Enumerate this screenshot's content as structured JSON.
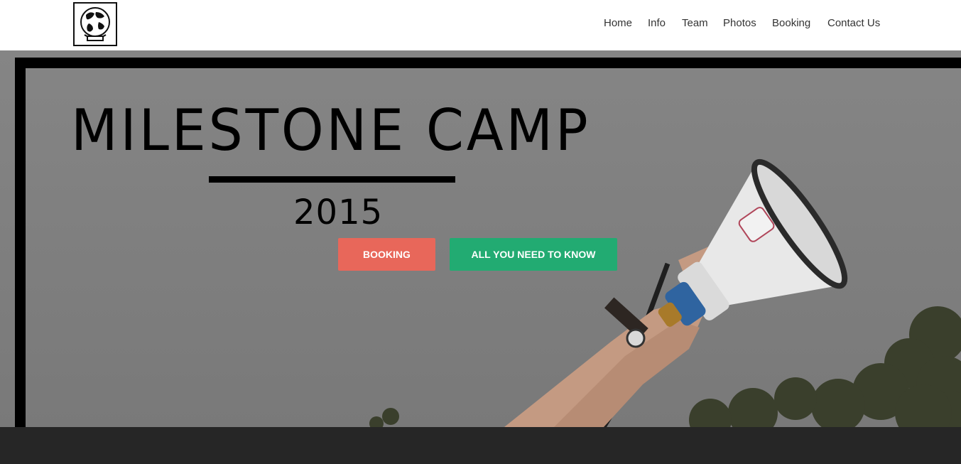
{
  "header": {
    "logo_alt": "globe logo",
    "nav": [
      "Home",
      "Info",
      "Team",
      "Photos",
      "Booking",
      "Contact Us"
    ]
  },
  "hero": {
    "title": "MILESTONE CAMP",
    "year": "2015",
    "buttons": {
      "booking": "BOOKING",
      "know": "ALL YOU NEED TO KNOW"
    }
  },
  "colors": {
    "booking_button": "#e8675a",
    "know_button": "#22ab72",
    "footer": "#262626",
    "overlay": "#7f7f7f"
  }
}
